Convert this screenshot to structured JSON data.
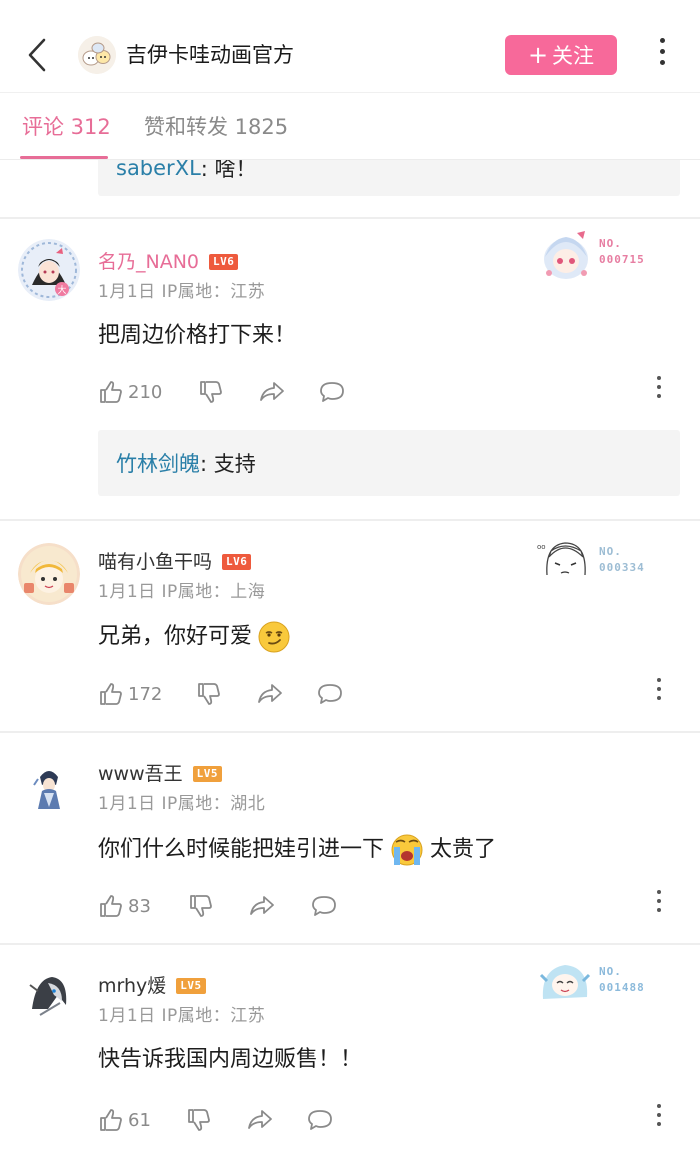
{
  "header": {
    "title": "吉伊卡哇动画官方",
    "follow_label": "关注",
    "accent": "#f7699a"
  },
  "tabs": [
    {
      "label": "评论 312"
    },
    {
      "label": "赞和转发 1825"
    }
  ],
  "top_reply": {
    "name": "saberXL",
    "text": ": 啥！"
  },
  "comments": [
    {
      "name": "名乃_NAN0",
      "level": "LV6",
      "meta": "1月1日  IP属地：江苏",
      "text": "把周边价格打下来！",
      "likes": "210",
      "medal_label": "NO.",
      "medal_no": "000715",
      "reply": {
        "name": "竹林剑魄",
        "text": ": 支持"
      }
    },
    {
      "name": "喵有小鱼干吗",
      "level": "LV6",
      "meta": "1月1日  IP属地：上海",
      "text": "兄弟，你好可爱",
      "likes": "172",
      "medal_label": "NO.",
      "medal_no": "000334"
    },
    {
      "name": "www吾王",
      "level": "LV5",
      "meta": "1月1日  IP属地：湖北",
      "text": "你们什么时候能把娃引进一下",
      "text_after": "太贵了",
      "likes": "83"
    },
    {
      "name": "mrhy煖",
      "level": "LV5",
      "meta": "1月1日  IP属地：江苏",
      "text": "快告诉我国内周边贩售！！",
      "likes": "61",
      "medal_label": "NO.",
      "medal_no": "001488"
    }
  ],
  "icons": {
    "back": "chevron-left-icon",
    "more": "more-vertical-icon",
    "like": "thumbs-up-icon",
    "dislike": "thumbs-down-icon",
    "share": "share-icon",
    "reply": "comment-bubble-icon"
  }
}
